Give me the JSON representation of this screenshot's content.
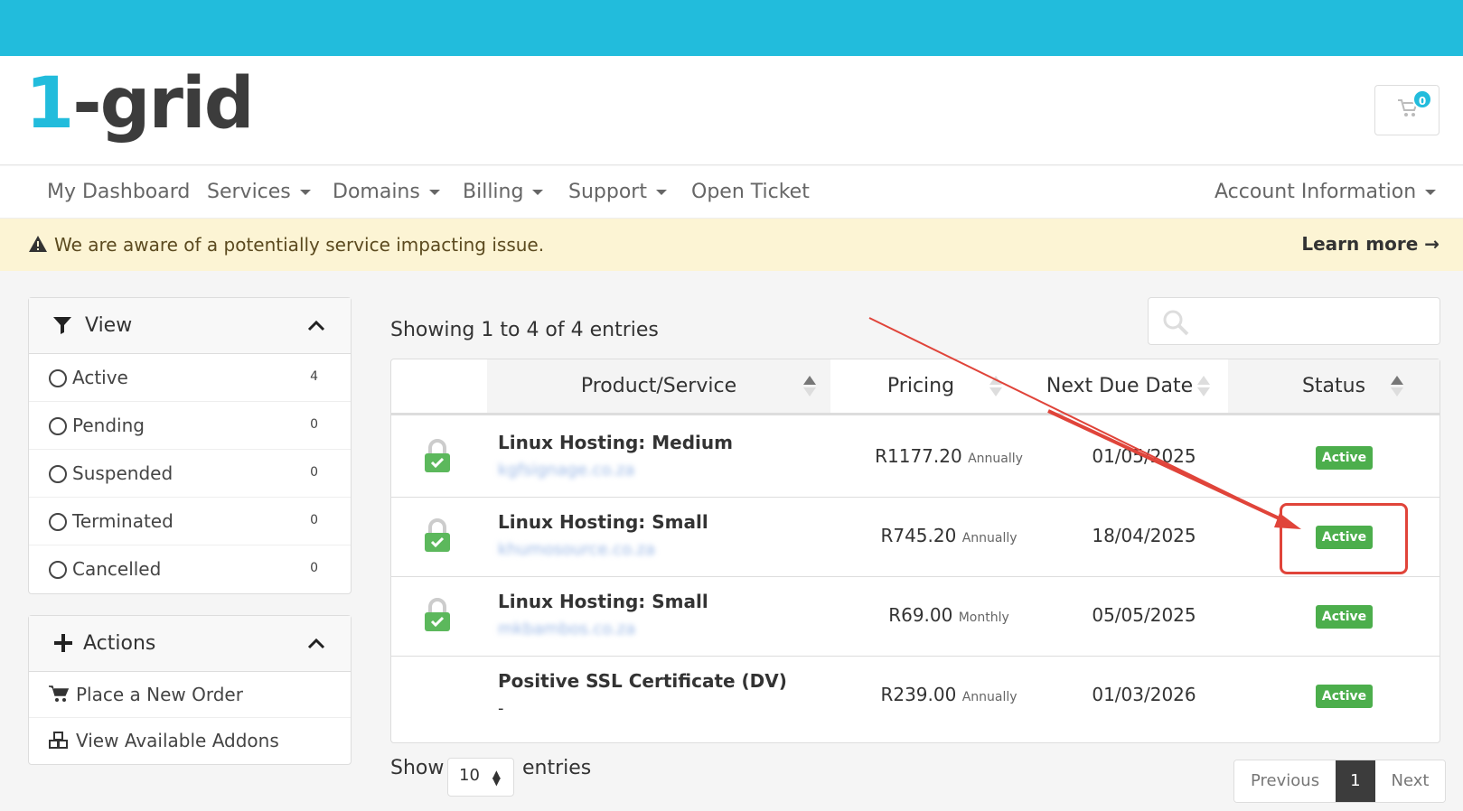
{
  "brand": {
    "logo_one": "1",
    "logo_rest": "-grid",
    "accent": "#22bcdc"
  },
  "cart": {
    "count": "0"
  },
  "nav": {
    "dashboard": "My Dashboard",
    "services": "Services",
    "domains": "Domains",
    "billing": "Billing",
    "support": "Support",
    "open_ticket": "Open Ticket",
    "account": "Account Information"
  },
  "alert": {
    "text": "We are aware of a potentially service impacting issue.",
    "link": "Learn more"
  },
  "view_panel": {
    "title": "View",
    "items": [
      {
        "label": "Active",
        "count": "4"
      },
      {
        "label": "Pending",
        "count": "0"
      },
      {
        "label": "Suspended",
        "count": "0"
      },
      {
        "label": "Terminated",
        "count": "0"
      },
      {
        "label": "Cancelled",
        "count": "0"
      }
    ]
  },
  "actions_panel": {
    "title": "Actions",
    "items": [
      {
        "label": "Place a New Order",
        "icon": "cart-icon"
      },
      {
        "label": "View Available Addons",
        "icon": "cubes-icon"
      }
    ]
  },
  "table": {
    "showing": "Showing 1 to 4 of 4 entries",
    "search_placeholder": "",
    "columns": [
      "Product/Service",
      "Pricing",
      "Next Due Date",
      "Status"
    ],
    "rows": [
      {
        "product": "Linux Hosting: Medium",
        "domain": "kgfsignage.co.za",
        "price": "R1177.20",
        "cycle": "Annually",
        "due": "01/05/2025",
        "status": "Active"
      },
      {
        "product": "Linux Hosting: Small",
        "domain": "khumosource.co.za",
        "price": "R745.20",
        "cycle": "Annually",
        "due": "18/04/2025",
        "status": "Active"
      },
      {
        "product": "Linux Hosting: Small",
        "domain": "mkbambos.co.za",
        "price": "R69.00",
        "cycle": "Monthly",
        "due": "05/05/2025",
        "status": "Active"
      },
      {
        "product": "Positive SSL Certificate (DV)",
        "domain": "-",
        "price": "R239.00",
        "cycle": "Annually",
        "due": "01/03/2026",
        "status": "Active"
      }
    ]
  },
  "footer": {
    "show": "Show",
    "length": "10",
    "entries": "entries",
    "previous": "Previous",
    "page": "1",
    "next": "Next"
  },
  "colors": {
    "status_active": "#4cae4c",
    "annotation": "#e0443a",
    "alert_bg": "#fcf4d4"
  }
}
